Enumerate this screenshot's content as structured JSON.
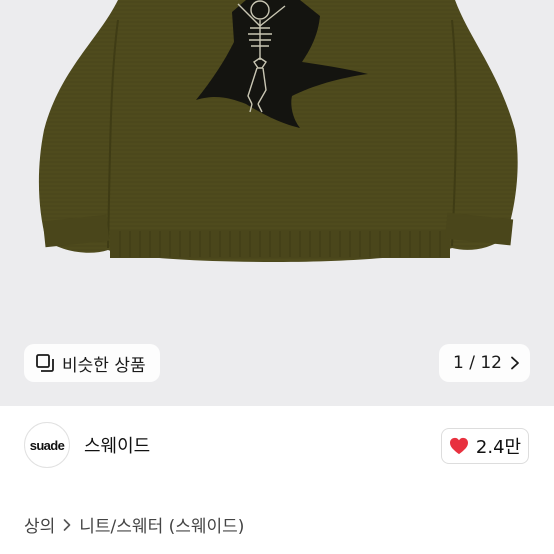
{
  "gallery": {
    "similar_label": "비슷한 상품",
    "pager": {
      "current": 1,
      "total": 12,
      "text": "1 / 12"
    },
    "product_color": "#4f4b1d",
    "graphic_color": "#141410"
  },
  "seller": {
    "avatar_text": "suade",
    "name": "스웨이드",
    "likes": "2.4만"
  },
  "breadcrumb": {
    "items": [
      "상의",
      "니트/스웨터 (스웨이드)"
    ]
  },
  "colors": {
    "like_heart": "#e8313f",
    "gallery_bg": "#ececee"
  },
  "icons": [
    "similar-products-icon",
    "chevron-right-icon",
    "heart-icon",
    "chevron-right-icon"
  ]
}
